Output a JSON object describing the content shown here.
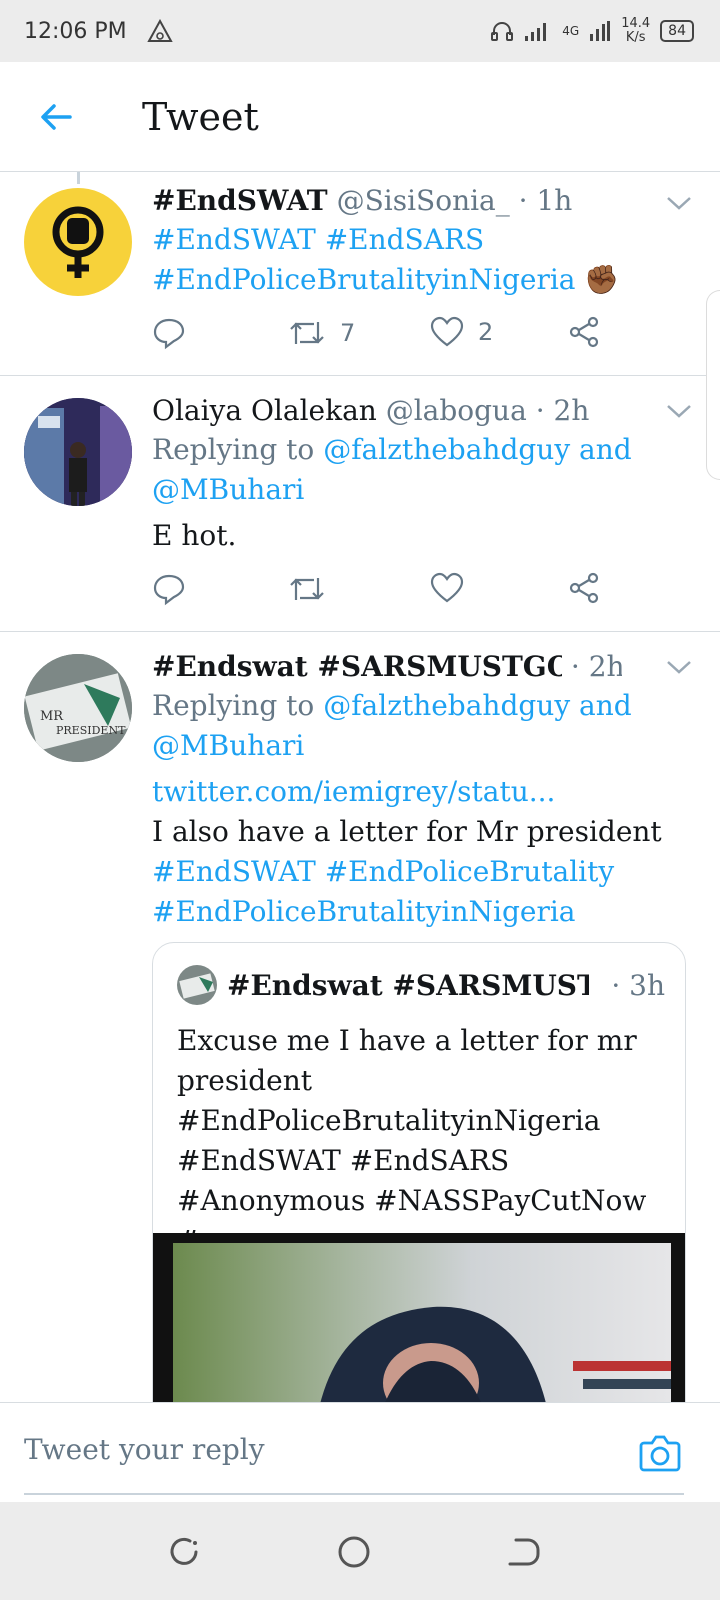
{
  "status_bar": {
    "time": "12:06 PM",
    "network": "4G",
    "speed_value": "14.4",
    "speed_unit": "K/s",
    "battery": "84"
  },
  "app_bar": {
    "title": "Tweet"
  },
  "tweets": [
    {
      "name": "#EndSWAT",
      "handle": "@SisiSonia_",
      "time": "· 1h",
      "line1": "#EndSWAT #EndSARS",
      "line2": "#EndPoliceBrutalityinNigeria",
      "emoji": "✊🏾",
      "retweets": "7",
      "likes": "2"
    },
    {
      "name": "Olaiya Olalekan",
      "handle": "@labogua",
      "time": "· 2h",
      "replying_prefix": "Replying to",
      "replying_to_1": "@falzthebahdguy and",
      "replying_to_2": "@MBuhari",
      "text": "E hot."
    },
    {
      "name": "#Endswat #SARSMUSTGO #...",
      "time": "· 2h",
      "replying_prefix": "Replying to",
      "replying_to_1": "@falzthebahdguy and",
      "replying_to_2": "@MBuhari",
      "link": "twitter.com/iemigrey/statu...",
      "text": "I also have a letter for Mr president",
      "hashtags_1": "#EndSWAT #EndPoliceBrutality",
      "hashtags_2": "#EndPoliceBrutalityinNigeria",
      "avatar_text_1": "MR",
      "avatar_text_2": "PRESIDENT"
    }
  ],
  "quoted_tweet": {
    "name": "#Endswat #SARSMUSTG...",
    "time": "· 3h",
    "line1": "Excuse me I have a letter for mr",
    "line2": "president",
    "line3": "#EndPoliceBrutalityinNigeria",
    "line4": "#EndSWAT #EndSARS",
    "line5": "#Anonymous #NASSPayCutNow #..."
  },
  "reply_bar": {
    "placeholder": "Tweet your reply"
  },
  "colors": {
    "accent": "#1da1f2",
    "secondary_text": "#657786",
    "avatar_yellow": "#f7d23a"
  }
}
